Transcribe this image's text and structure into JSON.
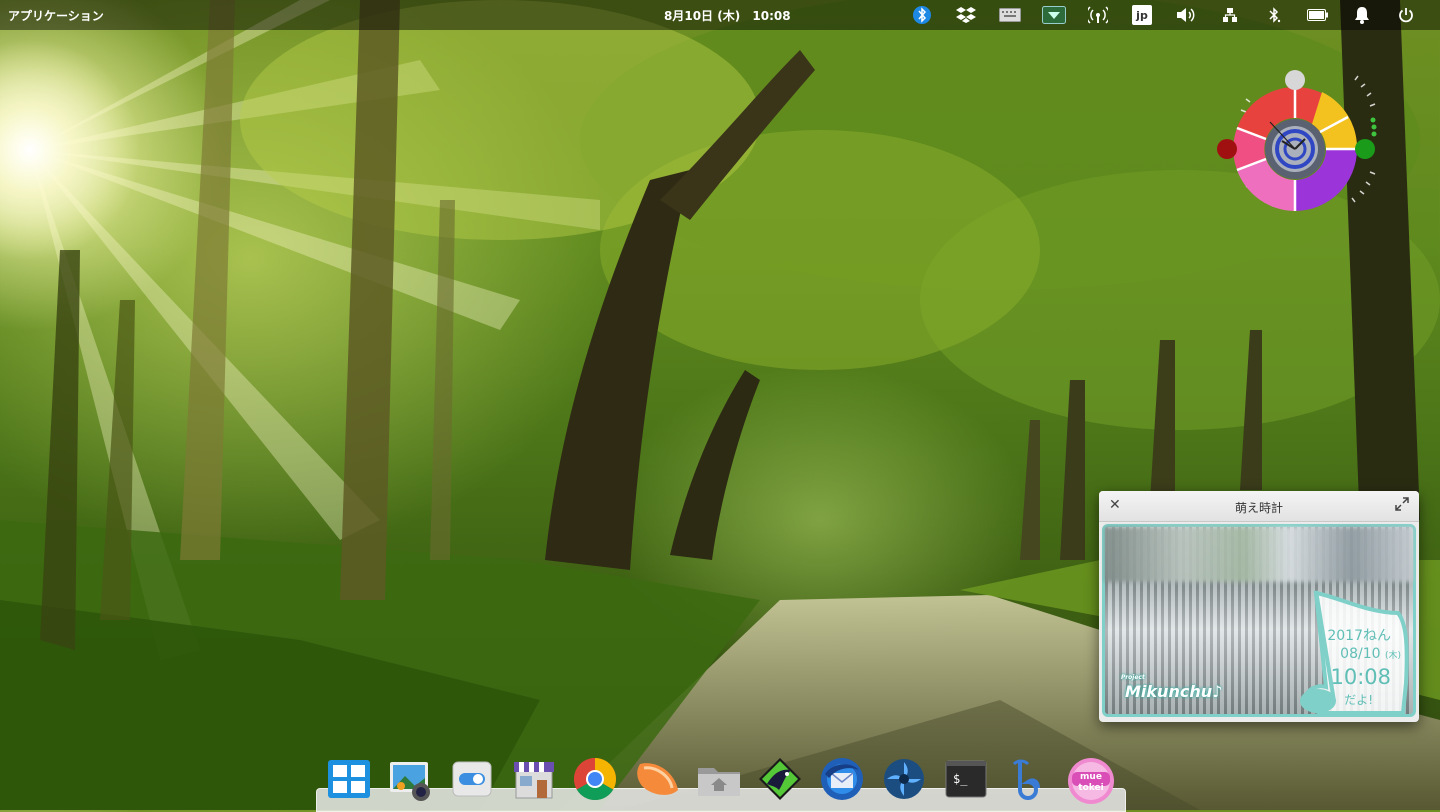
{
  "top_panel": {
    "apps_menu_label": "アプリケーション",
    "date": "8月10日 (木)",
    "time": "10:08",
    "keyboard_layout": "jp"
  },
  "indicators": [
    {
      "name": "bluetooth-app-icon"
    },
    {
      "name": "dropbox-icon"
    },
    {
      "name": "keyboard-icon"
    },
    {
      "name": "display-icon"
    },
    {
      "name": "wireless-icon"
    },
    {
      "name": "keyboard-layout-indicator"
    },
    {
      "name": "volume-icon"
    },
    {
      "name": "network-icon"
    },
    {
      "name": "bluetooth-icon"
    },
    {
      "name": "battery-icon"
    },
    {
      "name": "notifications-icon"
    },
    {
      "name": "power-icon"
    }
  ],
  "moe_clock": {
    "window_title": "萌え時計",
    "year_text": "2017ねん",
    "date_text": "08/10",
    "weekday_text": "(木)",
    "time_text": "10:08",
    "suffix_text": "だよ!",
    "logo_text": "Mikunchu♪",
    "logo_small": "Project"
  },
  "dock": {
    "items": [
      {
        "name": "multitasking-view-icon"
      },
      {
        "name": "photos-icon"
      },
      {
        "name": "system-settings-icon"
      },
      {
        "name": "appcenter-icon"
      },
      {
        "name": "chrome-icon"
      },
      {
        "name": "sublime-icon"
      },
      {
        "name": "files-icon"
      },
      {
        "name": "inkscape-icon"
      },
      {
        "name": "thunderbird-icon"
      },
      {
        "name": "shotwell-icon"
      },
      {
        "name": "terminal-icon"
      },
      {
        "name": "bibata-icon"
      },
      {
        "name": "moe-tokei-icon"
      }
    ],
    "terminal_label": "$_",
    "moe_icon_label": "mue tokei"
  },
  "colors": {
    "panel_bg": "#000000",
    "moe_accent": "#5fbfb6",
    "ring_red": "#e8423f",
    "ring_yellow": "#f4c21f",
    "ring_purple": "#9b35d9",
    "ring_pink": "#ee6fbd"
  }
}
